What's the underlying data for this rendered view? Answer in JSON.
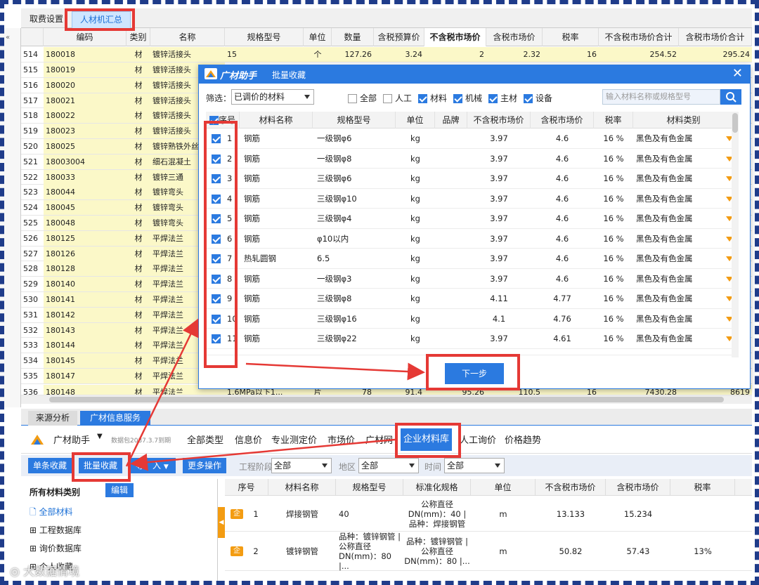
{
  "top_tabs": [
    "取费设置",
    "人材机汇总"
  ],
  "grid": {
    "headers": [
      "编码",
      "类别",
      "名称",
      "规格型号",
      "单位",
      "数量",
      "含税预算价",
      "不含税市场价",
      "含税市场价",
      "税率",
      "不含税市场价合计",
      "含税市场价合计"
    ],
    "first_row": {
      "no": "514",
      "code": "180018",
      "type": "材",
      "name": "镀锌活接头",
      "spec": "15",
      "unit": "个",
      "qty": "127.26",
      "budget": "3.24",
      "mkt_ex": "2",
      "mkt_in": "2.32",
      "tax": "16",
      "sum_ex": "254.52",
      "sum_in": "295.24"
    },
    "rows": [
      {
        "no": "515",
        "code": "180019",
        "type": "材",
        "name": "镀锌活接头"
      },
      {
        "no": "516",
        "code": "180020",
        "type": "材",
        "name": "镀锌活接头"
      },
      {
        "no": "517",
        "code": "180021",
        "type": "材",
        "name": "镀锌活接头"
      },
      {
        "no": "518",
        "code": "180022",
        "type": "材",
        "name": "镀锌活接头"
      },
      {
        "no": "519",
        "code": "180023",
        "type": "材",
        "name": "镀锌活接头"
      },
      {
        "no": "520",
        "code": "180025",
        "type": "材",
        "name": "镀锌熟铁外丝"
      },
      {
        "no": "521",
        "code": "18003004",
        "type": "材",
        "name": "细石混凝土"
      },
      {
        "no": "522",
        "code": "180033",
        "type": "材",
        "name": "镀锌三通"
      },
      {
        "no": "523",
        "code": "180044",
        "type": "材",
        "name": "镀锌弯头"
      },
      {
        "no": "524",
        "code": "180045",
        "type": "材",
        "name": "镀锌弯头"
      },
      {
        "no": "525",
        "code": "180048",
        "type": "材",
        "name": "镀锌弯头"
      },
      {
        "no": "526",
        "code": "180125",
        "type": "材",
        "name": "平焊法兰"
      },
      {
        "no": "527",
        "code": "180126",
        "type": "材",
        "name": "平焊法兰"
      },
      {
        "no": "528",
        "code": "180128",
        "type": "材",
        "name": "平焊法兰"
      },
      {
        "no": "529",
        "code": "180140",
        "type": "材",
        "name": "平焊法兰"
      },
      {
        "no": "530",
        "code": "180141",
        "type": "材",
        "name": "平焊法兰"
      },
      {
        "no": "531",
        "code": "180142",
        "type": "材",
        "name": "平焊法兰"
      },
      {
        "no": "532",
        "code": "180143",
        "type": "材",
        "name": "平焊法兰"
      },
      {
        "no": "533",
        "code": "180144",
        "type": "材",
        "name": "平焊法兰"
      },
      {
        "no": "534",
        "code": "180145",
        "type": "材",
        "name": "平焊法兰"
      },
      {
        "no": "535",
        "code": "180147",
        "type": "材",
        "name": "平焊法兰"
      }
    ],
    "last_row": {
      "no": "536",
      "code": "180148",
      "type": "材",
      "name": "平焊法兰",
      "spec": "1.6MPa以下1...",
      "unit": "片",
      "qty": "78",
      "budget": "91.4",
      "mkt_ex": "95.26",
      "mkt_in": "110.5",
      "tax": "16",
      "sum_ex": "7430.28",
      "sum_in": "8619"
    }
  },
  "dialog": {
    "brand": "广材助手",
    "title": "批量收藏",
    "close": "✕",
    "filter_label": "筛选：",
    "filter_value": "已调价的材料",
    "checks": [
      {
        "label": "全部",
        "on": false
      },
      {
        "label": "人工",
        "on": false
      },
      {
        "label": "材料",
        "on": true
      },
      {
        "label": "机械",
        "on": true
      },
      {
        "label": "主材",
        "on": true
      },
      {
        "label": "设备",
        "on": true
      }
    ],
    "search_placeholder": "输入材料名称或规格型号",
    "headers": [
      "序号",
      "材料名称",
      "规格型号",
      "单位",
      "品牌",
      "不含税市场价",
      "含税市场价",
      "税率",
      "材料类别"
    ],
    "rows": [
      {
        "no": "1",
        "name": "钢筋",
        "spec": "一级钢φ6",
        "unit": "kg",
        "ex": "3.97",
        "inc": "4.6",
        "tax": "16 %",
        "cat": "黑色及有色金属"
      },
      {
        "no": "2",
        "name": "钢筋",
        "spec": "一级钢φ8",
        "unit": "kg",
        "ex": "3.97",
        "inc": "4.6",
        "tax": "16 %",
        "cat": "黑色及有色金属"
      },
      {
        "no": "3",
        "name": "钢筋",
        "spec": "三级钢φ6",
        "unit": "kg",
        "ex": "3.97",
        "inc": "4.6",
        "tax": "16 %",
        "cat": "黑色及有色金属"
      },
      {
        "no": "4",
        "name": "钢筋",
        "spec": "三级钢φ10",
        "unit": "kg",
        "ex": "3.97",
        "inc": "4.6",
        "tax": "16 %",
        "cat": "黑色及有色金属"
      },
      {
        "no": "5",
        "name": "钢筋",
        "spec": "三级钢φ4",
        "unit": "kg",
        "ex": "3.97",
        "inc": "4.6",
        "tax": "16 %",
        "cat": "黑色及有色金属"
      },
      {
        "no": "6",
        "name": "钢筋",
        "spec": "φ10以内",
        "unit": "kg",
        "ex": "3.97",
        "inc": "4.6",
        "tax": "16 %",
        "cat": "黑色及有色金属"
      },
      {
        "no": "7",
        "name": "热轧圆钢",
        "spec": "6.5",
        "unit": "kg",
        "ex": "3.97",
        "inc": "4.6",
        "tax": "16 %",
        "cat": "黑色及有色金属"
      },
      {
        "no": "8",
        "name": "钢筋",
        "spec": "一级钢φ3",
        "unit": "kg",
        "ex": "3.97",
        "inc": "4.6",
        "tax": "16 %",
        "cat": "黑色及有色金属"
      },
      {
        "no": "9",
        "name": "钢筋",
        "spec": "三级钢φ8",
        "unit": "kg",
        "ex": "4.11",
        "inc": "4.77",
        "tax": "16 %",
        "cat": "黑色及有色金属"
      },
      {
        "no": "10",
        "name": "钢筋",
        "spec": "三级钢φ16",
        "unit": "kg",
        "ex": "4.1",
        "inc": "4.76",
        "tax": "16 %",
        "cat": "黑色及有色金属"
      },
      {
        "no": "11",
        "name": "钢筋",
        "spec": "三级钢φ22",
        "unit": "kg",
        "ex": "3.97",
        "inc": "4.61",
        "tax": "16 %",
        "cat": "黑色及有色金属"
      }
    ],
    "next_button": "下一步"
  },
  "bottom": {
    "tabs": [
      "来源分析",
      "广材信息服务"
    ],
    "nav_brand": "广材助手",
    "nav_pkg": "数据包2037.3.7到期",
    "nav_items": [
      "全部类型",
      "信息价",
      "专业测定价",
      "市场价",
      "广材网",
      "企业材料库",
      "人工询价",
      "价格趋势"
    ],
    "toolbar": {
      "single": "单条收藏",
      "batch": "批量收藏",
      "import": "导　入",
      "more": "更多操作",
      "stage_label": "工程阶段",
      "stage_value": "全部",
      "area_label": "地区",
      "area_value": "全部",
      "time_label": "时间",
      "time_value": "全部"
    },
    "left": {
      "title": "所有材料类别",
      "edit": "编辑",
      "items": [
        "全部材料",
        "工程数据库",
        "询价数据库",
        "个人收藏"
      ]
    },
    "right_headers": [
      "序号",
      "材料名称",
      "规格型号",
      "标准化规格",
      "单位",
      "不含税市场价",
      "含税市场价",
      "税率"
    ],
    "right_rows": [
      {
        "badge": "企",
        "no": "1",
        "name": "焊接钢管",
        "spec": "40",
        "std": "公称直径DN(mm)：40 | 品种：焊接钢管",
        "unit": "m",
        "ex": "13.133",
        "inc": "15.234",
        "tax": ""
      },
      {
        "badge": "企",
        "no": "2",
        "name": "镀锌钢管",
        "spec": "品种：镀锌钢管 | 公称直径DN(mm)：80 |...",
        "std": "品种：镀锌钢管 | 公称直径DN(mm)：80 |...",
        "unit": "m",
        "ex": "50.82",
        "inc": "57.43",
        "tax": "13%"
      }
    ]
  },
  "watermark": "大数据情境"
}
